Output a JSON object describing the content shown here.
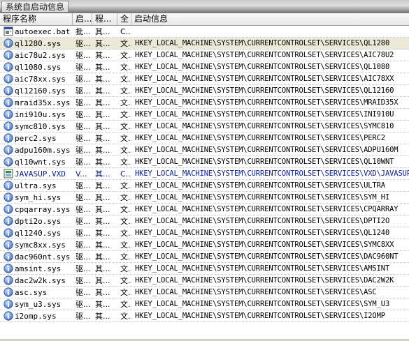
{
  "tab": {
    "label": "系统自启动信息"
  },
  "columns": {
    "name": "程序名称",
    "type": "启...",
    "source": "程...",
    "all": "全",
    "info": "启动信息"
  },
  "rows": [
    {
      "icon": "batch-file-icon",
      "name": "autoexec.bat",
      "type": "批...",
      "source": "其...",
      "all": "C...",
      "info": "",
      "selected": false
    },
    {
      "icon": "info-icon",
      "name": "ql1280.sys",
      "type": "驱...",
      "source": "其...",
      "all": "文...",
      "info": "HKEY_LOCAL_MACHINE\\SYSTEM\\CURRENTCONTROLSET\\SERVICES\\QL1280",
      "selected": true
    },
    {
      "icon": "info-icon",
      "name": "aic78u2.sys",
      "type": "驱...",
      "source": "其...",
      "all": "文...",
      "info": "HKEY_LOCAL_MACHINE\\SYSTEM\\CURRENTCONTROLSET\\SERVICES\\AIC78U2",
      "selected": false
    },
    {
      "icon": "info-icon",
      "name": "ql1080.sys",
      "type": "驱...",
      "source": "其...",
      "all": "文...",
      "info": "HKEY_LOCAL_MACHINE\\SYSTEM\\CURRENTCONTROLSET\\SERVICES\\QL1080",
      "selected": false
    },
    {
      "icon": "info-icon",
      "name": "aic78xx.sys",
      "type": "驱...",
      "source": "其...",
      "all": "文...",
      "info": "HKEY_LOCAL_MACHINE\\SYSTEM\\CURRENTCONTROLSET\\SERVICES\\AIC78XX",
      "selected": false
    },
    {
      "icon": "info-icon",
      "name": "ql12160.sys",
      "type": "驱...",
      "source": "其...",
      "all": "文...",
      "info": "HKEY_LOCAL_MACHINE\\SYSTEM\\CURRENTCONTROLSET\\SERVICES\\QL12160",
      "selected": false
    },
    {
      "icon": "info-icon",
      "name": "mraid35x.sys",
      "type": "驱...",
      "source": "其...",
      "all": "文...",
      "info": "HKEY_LOCAL_MACHINE\\SYSTEM\\CURRENTCONTROLSET\\SERVICES\\MRAID35X",
      "selected": false
    },
    {
      "icon": "info-icon",
      "name": "ini910u.sys",
      "type": "驱...",
      "source": "其...",
      "all": "文...",
      "info": "HKEY_LOCAL_MACHINE\\SYSTEM\\CURRENTCONTROLSET\\SERVICES\\INI910U",
      "selected": false
    },
    {
      "icon": "info-icon",
      "name": "symc810.sys",
      "type": "驱...",
      "source": "其...",
      "all": "文...",
      "info": "HKEY_LOCAL_MACHINE\\SYSTEM\\CURRENTCONTROLSET\\SERVICES\\SYMC810",
      "selected": false
    },
    {
      "icon": "info-icon",
      "name": "perc2.sys",
      "type": "驱...",
      "source": "其...",
      "all": "文...",
      "info": "HKEY_LOCAL_MACHINE\\SYSTEM\\CURRENTCONTROLSET\\SERVICES\\PERC2",
      "selected": false
    },
    {
      "icon": "info-icon",
      "name": "adpu160m.sys",
      "type": "驱...",
      "source": "其...",
      "all": "文...",
      "info": "HKEY_LOCAL_MACHINE\\SYSTEM\\CURRENTCONTROLSET\\SERVICES\\ADPU160M",
      "selected": false
    },
    {
      "icon": "info-icon",
      "name": "ql10wnt.sys",
      "type": "驱...",
      "source": "其...",
      "all": "文...",
      "info": "HKEY_LOCAL_MACHINE\\SYSTEM\\CURRENTCONTROLSET\\SERVICES\\QL10WNT",
      "selected": false
    },
    {
      "icon": "vxd-file-icon",
      "name": "JAVASUP.VXD",
      "type": "V...",
      "source": "其...",
      "all": "C...",
      "info": "HKEY_LOCAL_MACHINE\\SYSTEM\\CURRENTCONTROLSET\\SERVICES\\VXD\\JAVASUP",
      "selected": false
    },
    {
      "icon": "info-icon",
      "name": "ultra.sys",
      "type": "驱...",
      "source": "其...",
      "all": "文...",
      "info": "HKEY_LOCAL_MACHINE\\SYSTEM\\CURRENTCONTROLSET\\SERVICES\\ULTRA",
      "selected": false
    },
    {
      "icon": "info-icon",
      "name": "sym_hi.sys",
      "type": "驱...",
      "source": "其...",
      "all": "文...",
      "info": "HKEY_LOCAL_MACHINE\\SYSTEM\\CURRENTCONTROLSET\\SERVICES\\SYM_HI",
      "selected": false
    },
    {
      "icon": "info-icon",
      "name": "cpqarray.sys",
      "type": "驱...",
      "source": "其...",
      "all": "文...",
      "info": "HKEY_LOCAL_MACHINE\\SYSTEM\\CURRENTCONTROLSET\\SERVICES\\CPQARRAY",
      "selected": false
    },
    {
      "icon": "info-icon",
      "name": "dpti2o.sys",
      "type": "驱...",
      "source": "其...",
      "all": "文...",
      "info": "HKEY_LOCAL_MACHINE\\SYSTEM\\CURRENTCONTROLSET\\SERVICES\\DPTI2O",
      "selected": false
    },
    {
      "icon": "info-icon",
      "name": "ql1240.sys",
      "type": "驱...",
      "source": "其...",
      "all": "文...",
      "info": "HKEY_LOCAL_MACHINE\\SYSTEM\\CURRENTCONTROLSET\\SERVICES\\QL1240",
      "selected": false
    },
    {
      "icon": "info-icon",
      "name": "symc8xx.sys",
      "type": "驱...",
      "source": "其...",
      "all": "文...",
      "info": "HKEY_LOCAL_MACHINE\\SYSTEM\\CURRENTCONTROLSET\\SERVICES\\SYMC8XX",
      "selected": false
    },
    {
      "icon": "info-icon",
      "name": "dac960nt.sys",
      "type": "驱...",
      "source": "其...",
      "all": "文...",
      "info": "HKEY_LOCAL_MACHINE\\SYSTEM\\CURRENTCONTROLSET\\SERVICES\\DAC960NT",
      "selected": false
    },
    {
      "icon": "info-icon",
      "name": "amsint.sys",
      "type": "驱...",
      "source": "其...",
      "all": "文...",
      "info": "HKEY_LOCAL_MACHINE\\SYSTEM\\CURRENTCONTROLSET\\SERVICES\\AMSINT",
      "selected": false
    },
    {
      "icon": "info-icon",
      "name": "dac2w2k.sys",
      "type": "驱...",
      "source": "其...",
      "all": "文...",
      "info": "HKEY_LOCAL_MACHINE\\SYSTEM\\CURRENTCONTROLSET\\SERVICES\\DAC2W2K",
      "selected": false
    },
    {
      "icon": "info-icon",
      "name": "asc.sys",
      "type": "驱...",
      "source": "其...",
      "all": "文...",
      "info": "HKEY_LOCAL_MACHINE\\SYSTEM\\CURRENTCONTROLSET\\SERVICES\\ASC",
      "selected": false
    },
    {
      "icon": "info-icon",
      "name": "sym_u3.sys",
      "type": "驱...",
      "source": "其...",
      "all": "文...",
      "info": "HKEY_LOCAL_MACHINE\\SYSTEM\\CURRENTCONTROLSET\\SERVICES\\SYM_U3",
      "selected": false
    },
    {
      "icon": "info-icon",
      "name": "i2omp.sys",
      "type": "驱...",
      "source": "其...",
      "all": "文...",
      "info": "HKEY_LOCAL_MACHINE\\SYSTEM\\CURRENTCONTROLSET\\SERVICES\\I2OMP",
      "selected": false
    }
  ],
  "colors": {
    "info_icon": "#3f6fbf",
    "selected_row": "#ece9d8",
    "vxd_text": "#0a1f8f"
  }
}
